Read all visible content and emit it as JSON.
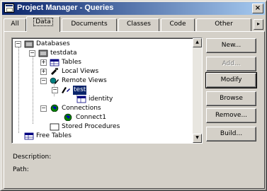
{
  "window": {
    "title": "Project Manager - Queries",
    "close_label": "×"
  },
  "tabs": [
    {
      "label": "All"
    },
    {
      "label": "Data"
    },
    {
      "label": "Documents"
    },
    {
      "label": "Classes"
    },
    {
      "label": "Code"
    },
    {
      "label": "Other"
    }
  ],
  "tab_scroll_label": "▸",
  "tree": {
    "databases": "Databases",
    "testdata": "testdata",
    "tables": "Tables",
    "local_views": "Local Views",
    "remote_views": "Remote Views",
    "test": "test",
    "identity": "identity",
    "connections": "Connections",
    "connect1": "Connect1",
    "stored_procedures": "Stored Procedures",
    "free_tables": "Free Tables"
  },
  "buttons": {
    "new": "New...",
    "add": "Add...",
    "modify": "Modify",
    "browse": "Browse",
    "remove": "Remove...",
    "build": "Build..."
  },
  "footer": {
    "description_label": "Description:",
    "path_label": "Path:"
  },
  "colors": {
    "title_start": "#0a246a",
    "selection": "#0a246a",
    "face": "#d4d0c8"
  }
}
